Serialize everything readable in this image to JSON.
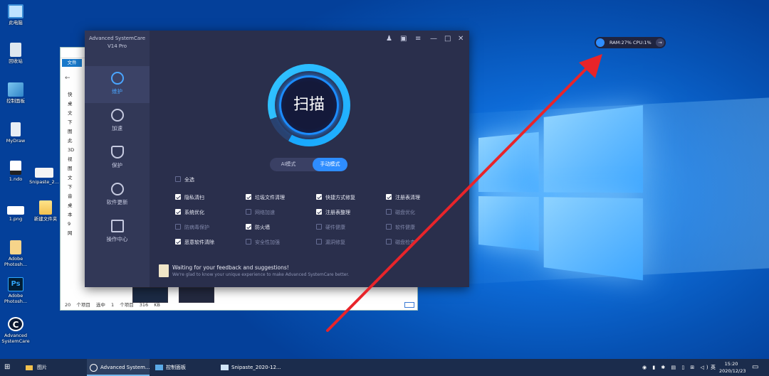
{
  "desktop": {
    "icons": [
      {
        "label": "此电脑",
        "icon": "computer-icon"
      },
      {
        "label": "回收站",
        "icon": "recycle-bin-icon"
      },
      {
        "label": "控制面板",
        "icon": "control-panel-icon"
      },
      {
        "label": "MyDraw",
        "icon": "mydraw-icon"
      },
      {
        "label": "1.ndo",
        "icon": "ndo-file-icon"
      },
      {
        "label": "Snipaste_2...",
        "icon": "image-file-icon"
      },
      {
        "label": "1.png",
        "icon": "png-file-icon"
      },
      {
        "label": "新建文件夹",
        "icon": "folder-icon"
      },
      {
        "label": "Adobe Photosh...",
        "icon": "photoshop-doc-icon"
      },
      {
        "label": "Adobe Photosh...",
        "icon": "photoshop-icon"
      },
      {
        "label": "Advanced SystemCare",
        "icon": "advanced-systemcare-icon"
      }
    ]
  },
  "explorer": {
    "tab": "文件",
    "sidebar": [
      "快",
      "桌",
      "文",
      "下",
      "图",
      "此",
      "3D",
      "视",
      "图",
      "文",
      "下",
      "音",
      "桌",
      "本",
      "9",
      "网"
    ],
    "status": {
      "items": "20 个项目",
      "selected": "选中 1 个项目",
      "size": "316 KB"
    }
  },
  "asc": {
    "brand": "Advanced SystemCare",
    "version": "V14 Pro",
    "nav": [
      {
        "label": "维护",
        "icon": "maintenance-icon",
        "active": true
      },
      {
        "label": "加速",
        "icon": "speedometer-icon",
        "active": false
      },
      {
        "label": "保护",
        "icon": "shield-icon",
        "active": false
      },
      {
        "label": "软件更新",
        "icon": "update-icon",
        "active": false
      },
      {
        "label": "操作中心",
        "icon": "action-center-icon",
        "active": false
      }
    ],
    "scan_label": "扫描",
    "modes": {
      "ai": "AI模式",
      "manual": "手动模式",
      "selected": "手动模式"
    },
    "select_all": "全选",
    "checkboxes": [
      {
        "label": "隐私清扫",
        "checked": true
      },
      {
        "label": "垃圾文件清理",
        "checked": true
      },
      {
        "label": "快捷方式修复",
        "checked": true
      },
      {
        "label": "注册表清理",
        "checked": true
      },
      {
        "label": "系统优化",
        "checked": true
      },
      {
        "label": "网络加速",
        "checked": false
      },
      {
        "label": "注册表整理",
        "checked": true
      },
      {
        "label": "磁盘优化",
        "checked": false
      },
      {
        "label": "防病毒保护",
        "checked": false
      },
      {
        "label": "防火墙",
        "checked": true
      },
      {
        "label": "硬件健康",
        "checked": false
      },
      {
        "label": "软件健康",
        "checked": false
      },
      {
        "label": "恶意软件清除",
        "checked": true
      },
      {
        "label": "安全性加强",
        "checked": false
      },
      {
        "label": "漏洞修复",
        "checked": false
      },
      {
        "label": "磁盘检查",
        "checked": false
      }
    ],
    "feedback": {
      "title": "Waiting for your feedback and suggestions!",
      "subtitle": "We're glad to know your unique experience to make Advanced SystemCare better."
    }
  },
  "ram_widget": {
    "ram": "RAM:27%",
    "cpu": "CPU:1%"
  },
  "taskbar": {
    "items": [
      {
        "label": "图片",
        "icon": "folder-icon"
      },
      {
        "label": "Advanced System...",
        "icon": "advanced-systemcare-icon"
      },
      {
        "label": "控制面板",
        "icon": "control-panel-icon"
      },
      {
        "label": "Snipaste_2020-12...",
        "icon": "snipaste-icon"
      }
    ],
    "ime": "英",
    "time": "15:20",
    "date": "2020/12/23"
  },
  "colors": {
    "accent": "#2e8dff",
    "arrow": "#e8242a",
    "asc_bg": "#2a2f4c"
  }
}
